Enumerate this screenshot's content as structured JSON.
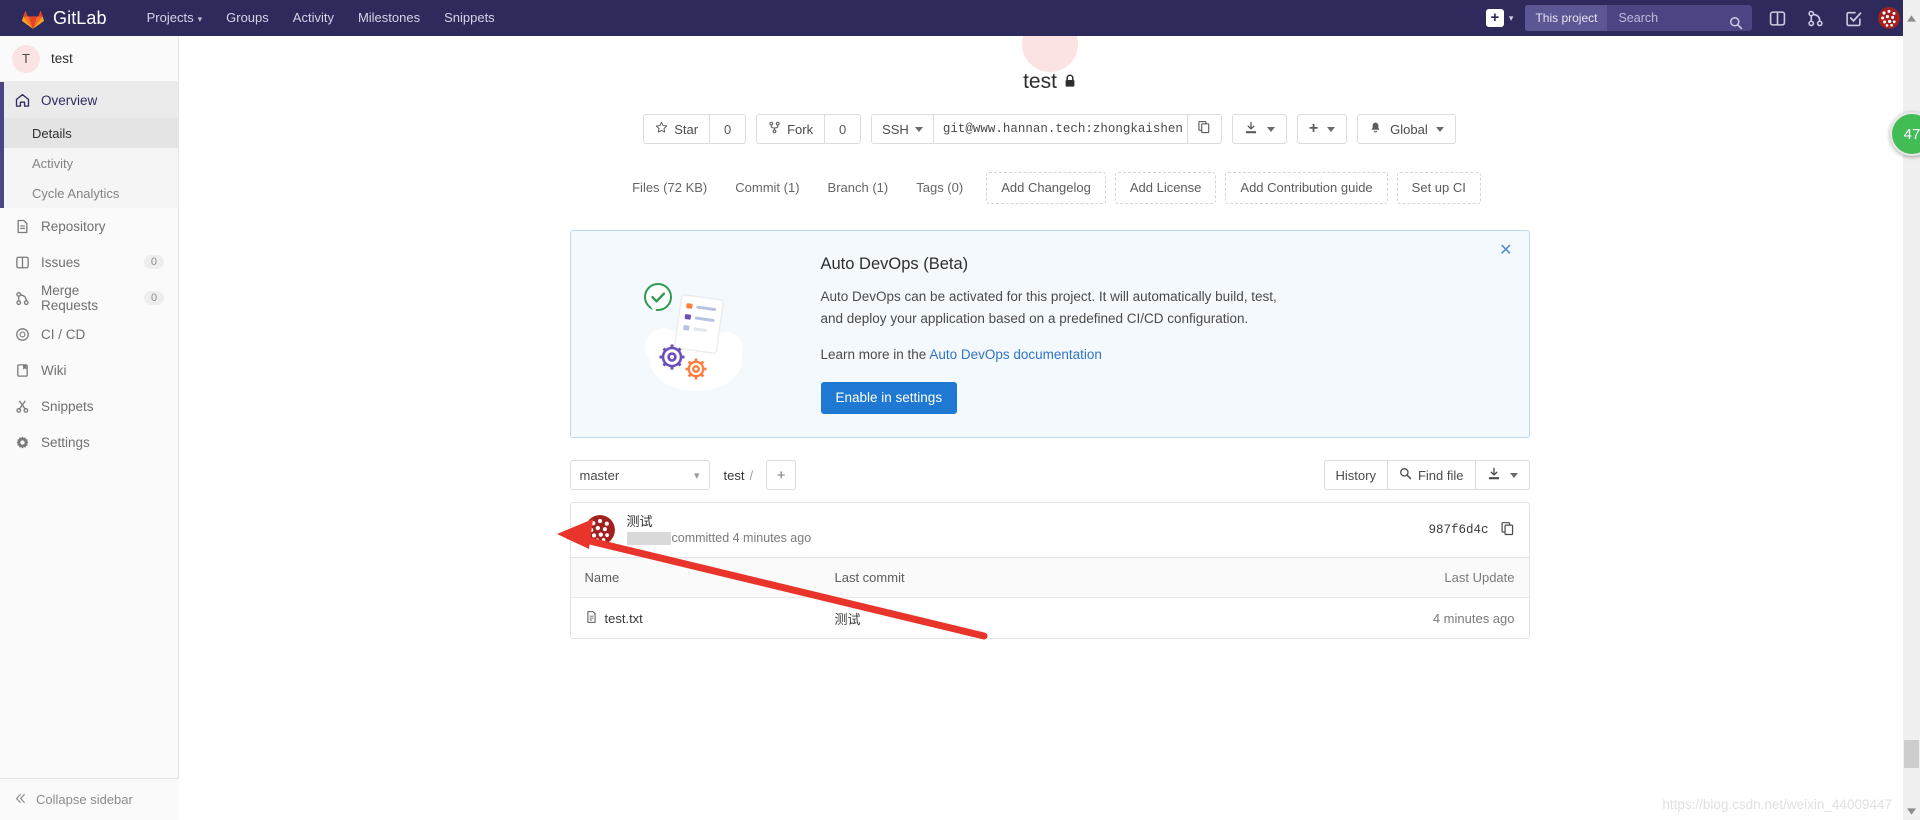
{
  "navbar": {
    "brand": "GitLab",
    "brand_icon": "gitlab-tanuki-icon",
    "links": [
      {
        "label": "Projects",
        "has_caret": true
      },
      {
        "label": "Groups",
        "has_caret": false
      },
      {
        "label": "Activity",
        "has_caret": false
      },
      {
        "label": "Milestones",
        "has_caret": false
      },
      {
        "label": "Snippets",
        "has_caret": false
      }
    ],
    "new_button_label": "+",
    "search": {
      "scope": "This project",
      "placeholder": "Search",
      "value": ""
    },
    "icons": [
      "issues-icon",
      "merge-requests-icon",
      "todos-icon"
    ],
    "user_caret": "▾"
  },
  "sidebar": {
    "project_initial": "T",
    "project_name": "test",
    "items": [
      {
        "label": "Overview",
        "icon": "home-icon",
        "active": true,
        "badge": ""
      },
      {
        "label": "Repository",
        "icon": "document-icon",
        "active": false,
        "badge": ""
      },
      {
        "label": "Issues",
        "icon": "issues-icon",
        "active": false,
        "badge": "0"
      },
      {
        "label": "Merge Requests",
        "icon": "merge-request-icon",
        "active": false,
        "badge": "0"
      },
      {
        "label": "CI / CD",
        "icon": "rocket-icon",
        "active": false,
        "badge": ""
      },
      {
        "label": "Wiki",
        "icon": "book-icon",
        "active": false,
        "badge": ""
      },
      {
        "label": "Snippets",
        "icon": "scissors-icon",
        "active": false,
        "badge": ""
      },
      {
        "label": "Settings",
        "icon": "gear-icon",
        "active": false,
        "badge": ""
      }
    ],
    "subitems": [
      {
        "label": "Details",
        "selected": true
      },
      {
        "label": "Activity",
        "selected": false
      },
      {
        "label": "Cycle Analytics",
        "selected": false
      }
    ],
    "collapse_label": "Collapse sidebar",
    "collapse_icon": "chevron-double-left-icon"
  },
  "project": {
    "title": "test",
    "visibility_icon": "lock-icon",
    "star_label": "Star",
    "star_count": "0",
    "fork_label": "Fork",
    "fork_count": "0",
    "clone_protocol": "SSH",
    "clone_url": "git@www.hannan.tech:zhongkaishen",
    "copy_icon": "copy-icon",
    "download_icon": "download-icon",
    "plus_icon": "plus-icon",
    "notification_label": "Global",
    "notification_icon": "bell-icon"
  },
  "project_tabs": [
    {
      "label": "Files (72 KB)",
      "dashed": false
    },
    {
      "label": "Commit (1)",
      "dashed": false
    },
    {
      "label": "Branch (1)",
      "dashed": false
    },
    {
      "label": "Tags (0)",
      "dashed": false
    },
    {
      "label": "Add Changelog",
      "dashed": true
    },
    {
      "label": "Add License",
      "dashed": true
    },
    {
      "label": "Add Contribution guide",
      "dashed": true
    },
    {
      "label": "Set up CI",
      "dashed": true
    }
  ],
  "devops_banner": {
    "heading": "Auto DevOps (Beta)",
    "body_line1": "Auto DevOps can be activated for this project. It will automatically build, test, and deploy",
    "body_line2": "your application based on a predefined CI/CD configuration.",
    "learn_prefix": "Learn more in the ",
    "learn_link": "Auto DevOps documentation",
    "button_label": "Enable in settings",
    "close_icon": "close-icon",
    "accent_color": "#1f78d1",
    "bg_color": "#f4f9fd",
    "border_color": "#bcd9ef"
  },
  "repo_toolbar": {
    "branch": "master",
    "breadcrumb_root": "test",
    "breadcrumb_sep": "/",
    "add_icon": "plus-icon",
    "history_label": "History",
    "find_file_label": "Find file",
    "find_file_icon": "search-icon",
    "download_icon": "download-icon"
  },
  "last_commit": {
    "message": "测试",
    "author_redacted": true,
    "meta_suffix": "committed 4 minutes ago",
    "sha": "987f6d4c",
    "copy_icon": "copy-icon",
    "avatar_icon": "user-avatar"
  },
  "file_table": {
    "columns": [
      "Name",
      "Last commit",
      "Last Update"
    ],
    "rows": [
      {
        "name": "test.txt",
        "icon": "file-text-icon",
        "last_commit": "测试",
        "last_update": "4 minutes ago"
      }
    ]
  },
  "overlays": {
    "annotation_arrow_color": "#e8342a",
    "green_badge_count": "47",
    "green_badge_color": "#42bd56",
    "watermark": "https://blog.csdn.net/weixin_44009447"
  }
}
